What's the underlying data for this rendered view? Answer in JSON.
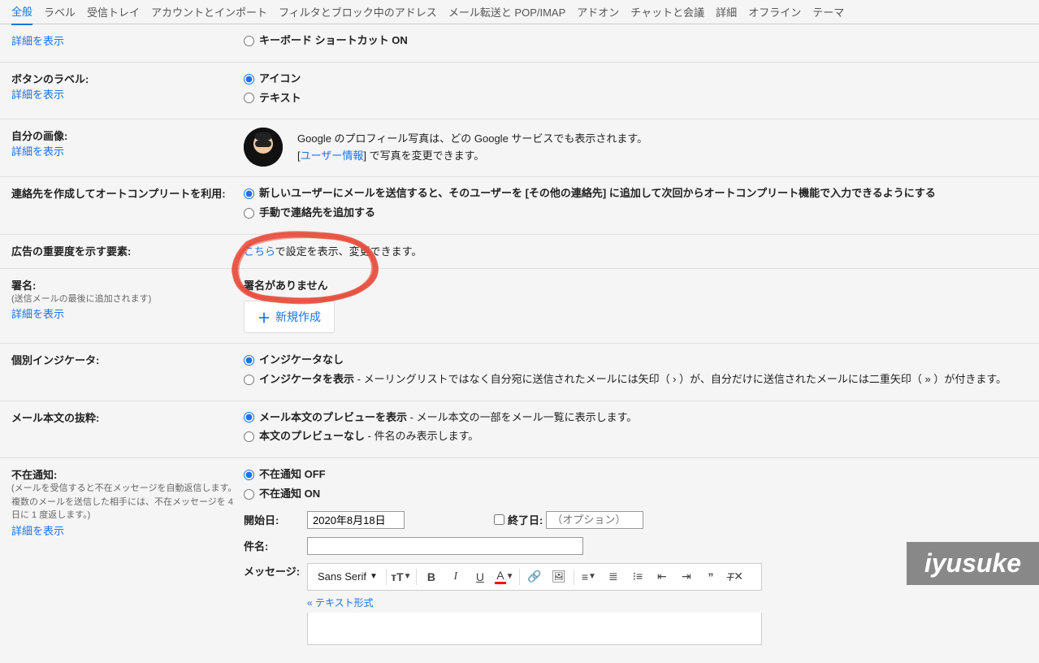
{
  "tabs": [
    "全般",
    "ラベル",
    "受信トレイ",
    "アカウントとインポート",
    "フィルタとブロック中のアドレス",
    "メール転送と POP/IMAP",
    "アドオン",
    "チャットと会議",
    "詳細",
    "オフライン",
    "テーマ"
  ],
  "shortcut": {
    "learn": "詳細を表示",
    "opt_on": "キーボード ショートカット ON"
  },
  "button_labels": {
    "title": "ボタンのラベル:",
    "learn": "詳細を表示",
    "opt_icon": "アイコン",
    "opt_text": "テキスト"
  },
  "my_picture": {
    "title": "自分の画像:",
    "learn": "詳細を表示",
    "desc1": "Google のプロフィール写真は、どの Google サービスでも表示されます。",
    "desc2a": "[",
    "desc2_link": "ユーザー情報",
    "desc2b": "] で写真を変更できます。"
  },
  "autocomplete": {
    "title": "連絡先を作成してオートコンプリートを利用:",
    "opt_auto": "新しいユーザーにメールを送信すると、そのユーザーを [その他の連絡先] に追加して次回からオートコンプリート機能で入力できるようにする",
    "opt_manual": "手動で連絡先を追加する"
  },
  "ads": {
    "title": "広告の重要度を示す要素:",
    "link": "こちら",
    "rest": "で設定を表示、変更できます。"
  },
  "signature": {
    "title": "署名:",
    "sub": "(送信メールの最後に追加されます)",
    "learn": "詳細を表示",
    "none": "署名がありません",
    "new": "新規作成"
  },
  "indicators": {
    "title": "個別インジケータ:",
    "opt_none": "インジケータなし",
    "opt_show_bold": "インジケータを表示",
    "opt_show_rest": " - メーリングリストではなく自分宛に送信されたメールには矢印（ › ）が、自分だけに送信されたメールには二重矢印（ » ）が付きます。"
  },
  "snippets": {
    "title": "メール本文の抜粋:",
    "opt_show_bold": "メール本文のプレビューを表示",
    "opt_show_rest": " - メール本文の一部をメール一覧に表示します。",
    "opt_hide_bold": "本文のプレビューなし",
    "opt_hide_rest": " - 件名のみ表示します。"
  },
  "vacation": {
    "title": "不在通知:",
    "sub": "(メールを受信すると不在メッセージを自動返信します。複数のメールを送信した相手には、不在メッセージを 4 日に 1 度返します。)",
    "learn": "詳細を表示",
    "opt_off": "不在通知 OFF",
    "opt_on": "不在通知 ON",
    "start_label": "開始日:",
    "start_value": "2020年8月18日",
    "end_label": "終了日:",
    "end_placeholder": "（オプション）",
    "subject_label": "件名:",
    "message_label": "メッセージ:",
    "font": "Sans Serif",
    "plain": "« テキスト形式"
  },
  "watermark": "iyusuke"
}
